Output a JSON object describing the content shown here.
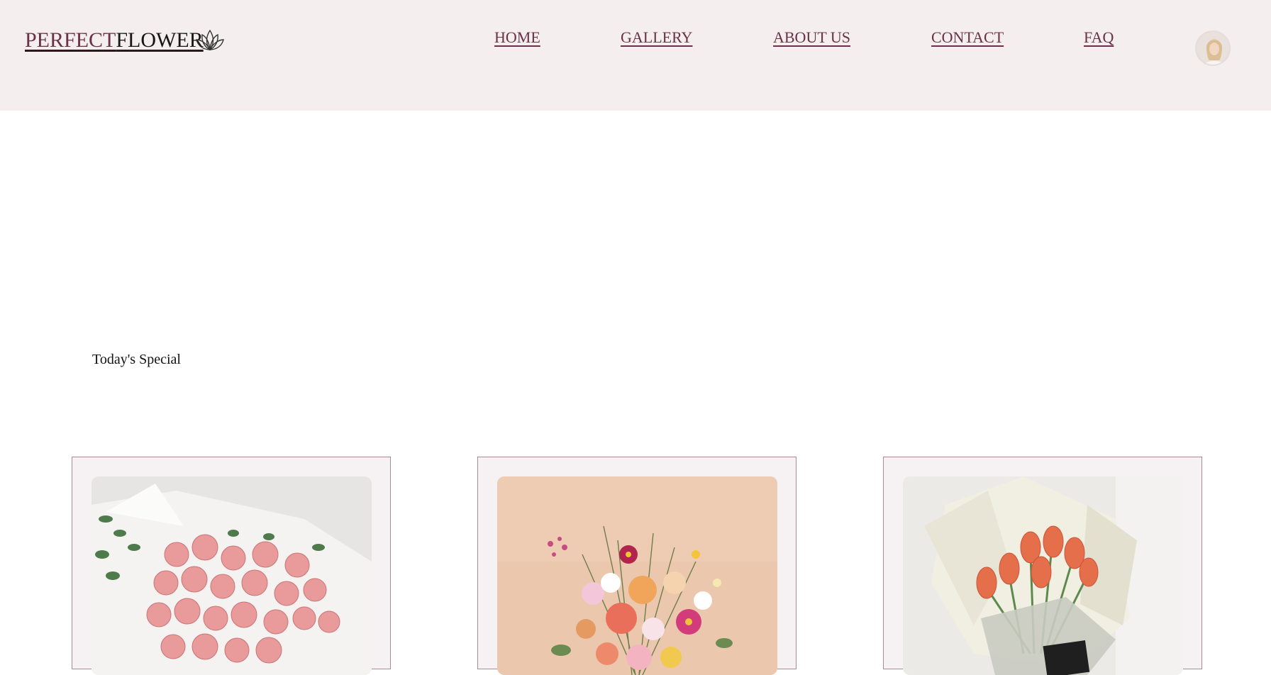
{
  "logo": {
    "text_part1": "PERFECT",
    "text_part2": "FLOWER",
    "icon": "lotus-icon"
  },
  "nav": {
    "items": [
      {
        "label": "HOME"
      },
      {
        "label": "GALLERY"
      },
      {
        "label": "ABOUT US"
      },
      {
        "label": "CONTACT"
      },
      {
        "label": "FAQ"
      }
    ]
  },
  "user": {
    "avatar": "user-avatar"
  },
  "specials": {
    "title": "Today's Special",
    "cards": [
      {
        "image": "pink-roses-bouquet-photo"
      },
      {
        "image": "mixed-dahlia-cosmos-bouquet-photo"
      },
      {
        "image": "orange-tulips-bouquet-photo"
      }
    ]
  },
  "colors": {
    "header_bg": "#f4eeee",
    "accent": "#6b3148",
    "card_bg": "#f6f1f2",
    "card_border": "#a88a95"
  }
}
